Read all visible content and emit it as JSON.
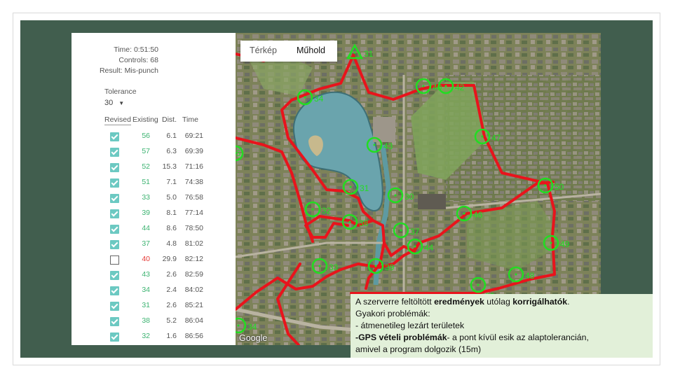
{
  "panel": {
    "time": "Time: 0:51:50",
    "controls": "Controls: 68",
    "result": "Result: Mis-punch",
    "tolerance_label": "Tolerance",
    "tolerance_value": "30",
    "headers": {
      "revised": "Revised",
      "existing": "Existing",
      "dist": "Dist.",
      "time": "Time"
    },
    "rows": [
      {
        "checked": true,
        "existing": "56",
        "dist": "6.1",
        "time": "69:21"
      },
      {
        "checked": true,
        "existing": "57",
        "dist": "6.3",
        "time": "69:39"
      },
      {
        "checked": true,
        "existing": "52",
        "dist": "15.3",
        "time": "71:16"
      },
      {
        "checked": true,
        "existing": "51",
        "dist": "7.1",
        "time": "74:38"
      },
      {
        "checked": true,
        "existing": "33",
        "dist": "5.0",
        "time": "76:58"
      },
      {
        "checked": true,
        "existing": "39",
        "dist": "8.1",
        "time": "77:14"
      },
      {
        "checked": true,
        "existing": "44",
        "dist": "8.6",
        "time": "78:50"
      },
      {
        "checked": true,
        "existing": "37",
        "dist": "4.8",
        "time": "81:02"
      },
      {
        "checked": false,
        "existing": "40",
        "dist": "29.9",
        "time": "82:12"
      },
      {
        "checked": true,
        "existing": "43",
        "dist": "2.6",
        "time": "82:59"
      },
      {
        "checked": true,
        "existing": "34",
        "dist": "2.4",
        "time": "84:02"
      },
      {
        "checked": true,
        "existing": "31",
        "dist": "2.6",
        "time": "85:21"
      },
      {
        "checked": true,
        "existing": "38",
        "dist": "5.2",
        "time": "86:04"
      },
      {
        "checked": true,
        "existing": "32",
        "dist": "1.6",
        "time": "86:56"
      }
    ]
  },
  "map": {
    "tabs": {
      "map": "Térkép",
      "satellite": "Műhold"
    },
    "attribution": "Google",
    "controls": [
      {
        "id": "start",
        "label": "31"
      },
      {
        "id": "c34",
        "label": "34"
      },
      {
        "id": "c40a",
        "label": "40"
      },
      {
        "id": "c42",
        "label": "42"
      },
      {
        "id": "c47",
        "label": "47"
      },
      {
        "id": "c43",
        "label": "43"
      },
      {
        "id": "c31",
        "label": "31"
      },
      {
        "id": "c50",
        "label": "50"
      },
      {
        "id": "c32",
        "label": "32"
      },
      {
        "id": "c38",
        "label": "38"
      },
      {
        "id": "c37",
        "label": "37"
      },
      {
        "id": "c46",
        "label": "46"
      },
      {
        "id": "c44",
        "label": "44"
      },
      {
        "id": "c49",
        "label": "49"
      },
      {
        "id": "c33",
        "label": "33"
      },
      {
        "id": "c39",
        "label": "39"
      },
      {
        "id": "c48",
        "label": "48"
      },
      {
        "id": "c96",
        "label": "96"
      },
      {
        "id": "c35",
        "label": "35"
      },
      {
        "id": "c30",
        "label": "30"
      },
      {
        "id": "c34b",
        "label": "34"
      }
    ]
  },
  "note": {
    "line1_pre": "A szerverre feltöltött ",
    "line1_bold1": "eredmények",
    "line1_mid": " utólag ",
    "line1_bold2": "korrigálhatók",
    "line1_post": ".",
    "line2": "Gyakori problémák:",
    "line3": "- átmenetileg lezárt területek",
    "line4_bold": "-GPS vételi problémák",
    "line4_rest": "- a pont kívül esik az alaptolerancián,",
    "line5": "amivel a program dolgozik (15m)"
  },
  "colors": {
    "background": "#415e4e",
    "route": "#e8141c",
    "control": "#22dd22",
    "note_bg": "#e2f0d9",
    "existing_ok": "#3cb371",
    "existing_bad": "#e53935"
  }
}
